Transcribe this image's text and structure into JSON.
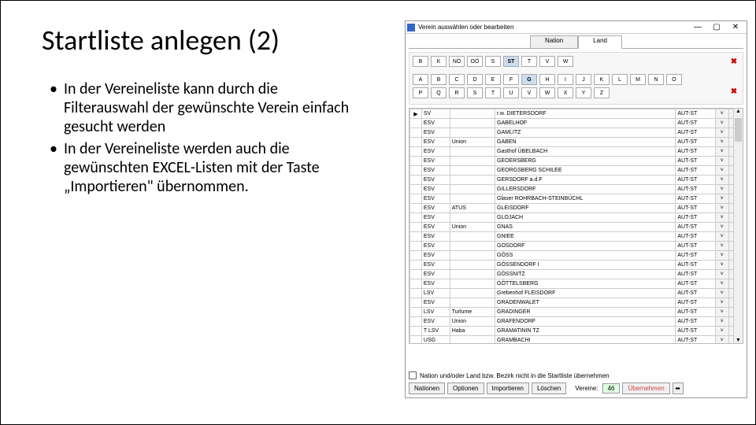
{
  "slide": {
    "title": "Startliste anlegen (2)",
    "bullets": [
      "In der Vereineliste kann durch die Filterauswahl der gewünschte Verein einfach gesucht werden",
      "In der Vereineliste werden auch die gewünschten EXCEL-Listen mit der Taste „Importieren\" übernommen."
    ]
  },
  "dialog": {
    "title": "Verein auswählen oder bearbeiten",
    "win_min": "—",
    "win_max": "▢",
    "win_close": "✕",
    "tabs": {
      "nation": "Nation",
      "land": "Land",
      "active": "land"
    },
    "land_filter": [
      "B",
      "K",
      "NÖ",
      "OÖ",
      "S",
      "ST",
      "T",
      "V",
      "W"
    ],
    "land_selected": "ST",
    "alpha_filter_row1": [
      "A",
      "B",
      "C",
      "D",
      "E",
      "F",
      "G",
      "H",
      "I",
      "J",
      "K",
      "L",
      "M",
      "N",
      "O"
    ],
    "alpha_filter_row2": [
      "P",
      "Q",
      "R",
      "S",
      "T",
      "U",
      "V",
      "W",
      "X",
      "Y",
      "Z"
    ],
    "alpha_selected": "G",
    "clear_icon": "✖",
    "rows": [
      {
        "p": "▶",
        "pre": "SV",
        "u": "",
        "name": "r.w. DIETERSDORF",
        "nat": "AUT-ST",
        "dd": "˅",
        "a": "▲"
      },
      {
        "p": "",
        "pre": "ESV",
        "u": "",
        "name": "GABELHOF",
        "nat": "AUT-ST",
        "dd": "˅",
        "a": "▲"
      },
      {
        "p": "",
        "pre": "ESV",
        "u": "",
        "name": "GAMLITZ",
        "nat": "AUT-ST",
        "dd": "˅",
        "a": "▼"
      },
      {
        "p": "",
        "pre": "ESV",
        "u": "Union",
        "name": "GABEN",
        "nat": "AUT-ST",
        "dd": "˅",
        "a": "▼"
      },
      {
        "p": "",
        "pre": "ESV",
        "u": "",
        "name": "Gasthof ÜBELBACH",
        "nat": "AUT-ST",
        "dd": "˅",
        "a": "▼"
      },
      {
        "p": "",
        "pre": "ESV",
        "u": "",
        "name": "GEOERSBERG",
        "nat": "AUT-ST",
        "dd": "˅",
        "a": "▼"
      },
      {
        "p": "",
        "pre": "ESV",
        "u": "",
        "name": "GEORGSBERG SCHILEE",
        "nat": "AUT-ST",
        "dd": "˅",
        "a": "▼"
      },
      {
        "p": "",
        "pre": "ESV",
        "u": "",
        "name": "GERSDORF a.d.F",
        "nat": "AUT-ST",
        "dd": "˅",
        "a": "▼"
      },
      {
        "p": "",
        "pre": "ESV",
        "u": "",
        "name": "GILLERSDORF",
        "nat": "AUT-ST",
        "dd": "˅",
        "a": "▲"
      },
      {
        "p": "",
        "pre": "ESV",
        "u": "",
        "name": "Glaser ROHRBACH-STEINBÜCHL",
        "nat": "AUT-ST",
        "dd": "˅",
        "a": "▲"
      },
      {
        "p": "",
        "pre": "ESV",
        "u": "ATUS",
        "name": "GLEISDORF",
        "nat": "AUT-ST",
        "dd": "˅",
        "a": "▲"
      },
      {
        "p": "",
        "pre": "ESV",
        "u": "",
        "name": "GLOJACH",
        "nat": "AUT-ST",
        "dd": "˅",
        "a": "▲"
      },
      {
        "p": "",
        "pre": "ESV",
        "u": "Union",
        "name": "GNAS",
        "nat": "AUT-ST",
        "dd": "˅",
        "a": "▲"
      },
      {
        "p": "",
        "pre": "ESV",
        "u": "",
        "name": "GNIEE",
        "nat": "AUT-ST",
        "dd": "˅",
        "a": "▼"
      },
      {
        "p": "",
        "pre": "ESV",
        "u": "",
        "name": "GOSDORF",
        "nat": "AUT-ST",
        "dd": "˅",
        "a": "▼"
      },
      {
        "p": "",
        "pre": "ESV",
        "u": "",
        "name": "GÖSS",
        "nat": "AUT-ST",
        "dd": "˅",
        "a": "▼"
      },
      {
        "p": "",
        "pre": "ESV",
        "u": "",
        "name": "GÖSSENDORF I",
        "nat": "AUT-ST",
        "dd": "˅",
        "a": "▼"
      },
      {
        "p": "",
        "pre": "ESV",
        "u": "",
        "name": "GÖSSNITZ",
        "nat": "AUT-ST",
        "dd": "˅",
        "a": "▼"
      },
      {
        "p": "",
        "pre": "ESV",
        "u": "",
        "name": "GÖTTELSBERG",
        "nat": "AUT-ST",
        "dd": "˅",
        "a": "■"
      },
      {
        "p": "",
        "pre": "LSV",
        "u": "",
        "name": "Grebenhof FLEISDORF",
        "nat": "AUT-ST",
        "dd": "˅",
        "a": "■"
      },
      {
        "p": "",
        "pre": "ESV",
        "u": "",
        "name": "GRADENWALET",
        "nat": "AUT-ST",
        "dd": "˅",
        "a": "■"
      },
      {
        "p": "",
        "pre": "LSV",
        "u": "Turlume",
        "name": "GRADINGER",
        "nat": "AUT-ST",
        "dd": "˅",
        "a": "■"
      },
      {
        "p": "",
        "pre": "ESV",
        "u": "Union",
        "name": "GRAFENDORF",
        "nat": "AUT-ST",
        "dd": "˅",
        "a": "■"
      },
      {
        "p": "",
        "pre": "T LSV",
        "u": "Haba",
        "name": "GRAMATININ TZ",
        "nat": "AUT-ST",
        "dd": "˅",
        "a": "■"
      },
      {
        "p": "",
        "pre": "USG",
        "u": "",
        "name": "GRAMBACHI",
        "nat": "AUT-ST",
        "dd": "˅",
        "a": "▼"
      }
    ],
    "checkbox_label": "Nation und/oder Land bzw. Bezirk nicht in die Startliste übernehmen",
    "buttons": {
      "nations": "Nationen",
      "options": "Optionen",
      "import": "Importieren",
      "delete": "Löschen",
      "count_label": "Vereine:",
      "count_value": "46",
      "take": "Übernehmen",
      "close": "⬌"
    }
  }
}
